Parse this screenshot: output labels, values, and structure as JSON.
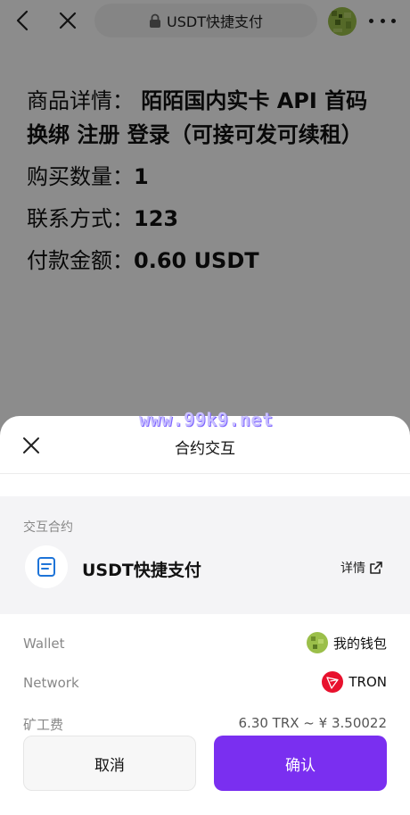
{
  "topbar": {
    "url_title": "USDT快捷支付"
  },
  "order": {
    "product_key": "商品详情：",
    "product_value": "陌陌国内实卡 API 首码 换绑 注册 登录（可接可发可续租）",
    "quantity_key": "购买数量：",
    "quantity_value": "1",
    "contact_key": "联系方式：",
    "contact_value": "123",
    "amount_key": "付款金额：",
    "amount_value": "0.60 USDT"
  },
  "watermark": "www.99k9.net",
  "sheet": {
    "title": "合约交互",
    "contract_label": "交互合约",
    "contract_name": "USDT快捷支付",
    "detail_link": "详情",
    "wallet_label": "Wallet",
    "wallet_value": "我的钱包",
    "network_label": "Network",
    "network_value": "TRON",
    "fee_label": "矿工费",
    "fee_value": "6.30 TRX ~ ¥ 3.50022",
    "cancel_label": "取消",
    "confirm_label": "确认"
  },
  "colors": {
    "accent": "#7a2ff0",
    "tron_red": "#e8112d"
  }
}
